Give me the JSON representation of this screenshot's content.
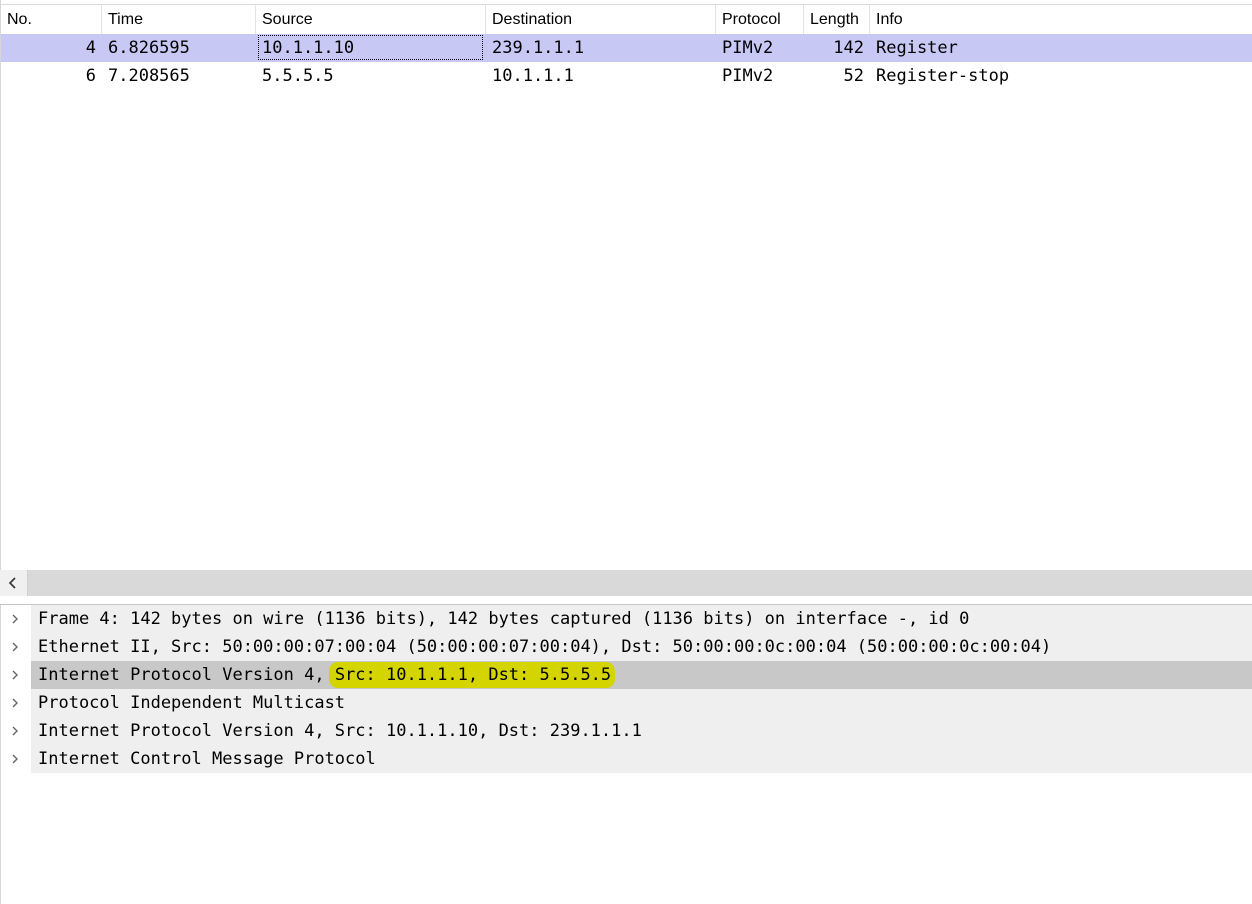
{
  "packet_list": {
    "columns": [
      "No.",
      "Time",
      "Source",
      "Destination",
      "Protocol",
      "Length",
      "Info"
    ],
    "rows": [
      {
        "no": "4",
        "time": "6.826595",
        "source": "10.1.1.10",
        "destination": "239.1.1.1",
        "protocol": "PIMv2",
        "length": "142",
        "info": "Register",
        "selected": true
      },
      {
        "no": "6",
        "time": "7.208565",
        "source": "5.5.5.5",
        "destination": "10.1.1.1",
        "protocol": "PIMv2",
        "length": "52",
        "info": "Register-stop",
        "selected": false
      }
    ]
  },
  "scrollbar": {
    "left_arrow_icon": "chevron-left-icon"
  },
  "details": {
    "expander_icon": "chevron-right-icon",
    "items": [
      {
        "text": "Frame 4: 142 bytes on wire (1136 bits), 142 bytes captured (1136 bits) on interface -, id 0"
      },
      {
        "text": "Ethernet II, Src: 50:00:00:07:00:04 (50:00:00:07:00:04), Dst: 50:00:00:0c:00:04 (50:00:00:0c:00:04)"
      },
      {
        "text_before": "Internet Protocol Version 4, ",
        "highlight": "Src: 10.1.1.1, Dst: 5.5.5.5",
        "selected": true
      },
      {
        "text": "Protocol Independent Multicast"
      },
      {
        "text": "Internet Protocol Version 4, Src: 10.1.1.10, Dst: 239.1.1.1"
      },
      {
        "text": "Internet Control Message Protocol"
      }
    ]
  },
  "colors": {
    "selected_row": "#c8c8f5",
    "selected_tree_row": "#c8c8c8",
    "highlighter": "#d4d400",
    "tree_row_bg": "#efefef"
  }
}
